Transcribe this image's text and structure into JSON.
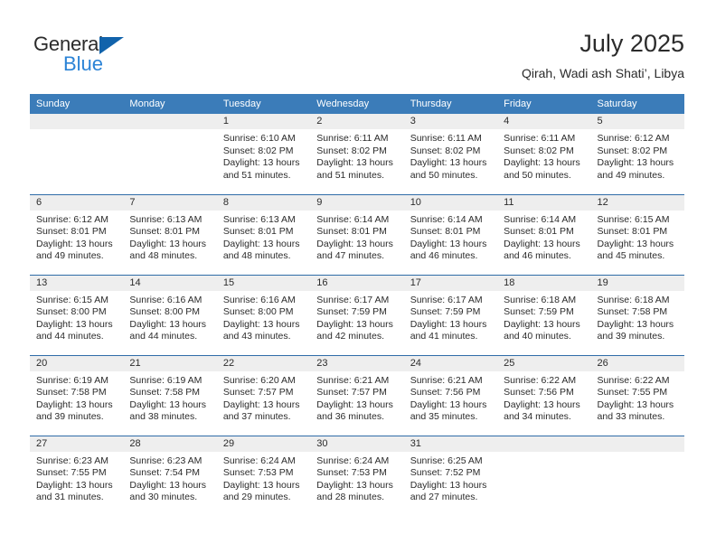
{
  "brand": {
    "name_top": "General",
    "name_bottom": "Blue",
    "logo_icon": "blue-triangle-icon",
    "accent_color": "#1163ab",
    "secondary_color": "#2b83d6"
  },
  "header": {
    "title": "July 2025",
    "subtitle": "Qirah, Wadi ash Shati’, Libya"
  },
  "theme": {
    "header_row_bg": "#3b7cb9",
    "header_row_text": "#ffffff",
    "daynum_band_bg": "#eeeeee",
    "week_divider": "#2f6ca8",
    "body_text": "#2b2b2b"
  },
  "weekday_headers": [
    "Sunday",
    "Monday",
    "Tuesday",
    "Wednesday",
    "Thursday",
    "Friday",
    "Saturday"
  ],
  "weeks": [
    [
      {
        "day": "",
        "empty": true
      },
      {
        "day": "",
        "empty": true
      },
      {
        "day": "1",
        "sunrise": "Sunrise: 6:10 AM",
        "sunset": "Sunset: 8:02 PM",
        "daylight_1": "Daylight: 13 hours",
        "daylight_2": "and 51 minutes."
      },
      {
        "day": "2",
        "sunrise": "Sunrise: 6:11 AM",
        "sunset": "Sunset: 8:02 PM",
        "daylight_1": "Daylight: 13 hours",
        "daylight_2": "and 51 minutes."
      },
      {
        "day": "3",
        "sunrise": "Sunrise: 6:11 AM",
        "sunset": "Sunset: 8:02 PM",
        "daylight_1": "Daylight: 13 hours",
        "daylight_2": "and 50 minutes."
      },
      {
        "day": "4",
        "sunrise": "Sunrise: 6:11 AM",
        "sunset": "Sunset: 8:02 PM",
        "daylight_1": "Daylight: 13 hours",
        "daylight_2": "and 50 minutes."
      },
      {
        "day": "5",
        "sunrise": "Sunrise: 6:12 AM",
        "sunset": "Sunset: 8:02 PM",
        "daylight_1": "Daylight: 13 hours",
        "daylight_2": "and 49 minutes."
      }
    ],
    [
      {
        "day": "6",
        "sunrise": "Sunrise: 6:12 AM",
        "sunset": "Sunset: 8:01 PM",
        "daylight_1": "Daylight: 13 hours",
        "daylight_2": "and 49 minutes."
      },
      {
        "day": "7",
        "sunrise": "Sunrise: 6:13 AM",
        "sunset": "Sunset: 8:01 PM",
        "daylight_1": "Daylight: 13 hours",
        "daylight_2": "and 48 minutes."
      },
      {
        "day": "8",
        "sunrise": "Sunrise: 6:13 AM",
        "sunset": "Sunset: 8:01 PM",
        "daylight_1": "Daylight: 13 hours",
        "daylight_2": "and 48 minutes."
      },
      {
        "day": "9",
        "sunrise": "Sunrise: 6:14 AM",
        "sunset": "Sunset: 8:01 PM",
        "daylight_1": "Daylight: 13 hours",
        "daylight_2": "and 47 minutes."
      },
      {
        "day": "10",
        "sunrise": "Sunrise: 6:14 AM",
        "sunset": "Sunset: 8:01 PM",
        "daylight_1": "Daylight: 13 hours",
        "daylight_2": "and 46 minutes."
      },
      {
        "day": "11",
        "sunrise": "Sunrise: 6:14 AM",
        "sunset": "Sunset: 8:01 PM",
        "daylight_1": "Daylight: 13 hours",
        "daylight_2": "and 46 minutes."
      },
      {
        "day": "12",
        "sunrise": "Sunrise: 6:15 AM",
        "sunset": "Sunset: 8:01 PM",
        "daylight_1": "Daylight: 13 hours",
        "daylight_2": "and 45 minutes."
      }
    ],
    [
      {
        "day": "13",
        "sunrise": "Sunrise: 6:15 AM",
        "sunset": "Sunset: 8:00 PM",
        "daylight_1": "Daylight: 13 hours",
        "daylight_2": "and 44 minutes."
      },
      {
        "day": "14",
        "sunrise": "Sunrise: 6:16 AM",
        "sunset": "Sunset: 8:00 PM",
        "daylight_1": "Daylight: 13 hours",
        "daylight_2": "and 44 minutes."
      },
      {
        "day": "15",
        "sunrise": "Sunrise: 6:16 AM",
        "sunset": "Sunset: 8:00 PM",
        "daylight_1": "Daylight: 13 hours",
        "daylight_2": "and 43 minutes."
      },
      {
        "day": "16",
        "sunrise": "Sunrise: 6:17 AM",
        "sunset": "Sunset: 7:59 PM",
        "daylight_1": "Daylight: 13 hours",
        "daylight_2": "and 42 minutes."
      },
      {
        "day": "17",
        "sunrise": "Sunrise: 6:17 AM",
        "sunset": "Sunset: 7:59 PM",
        "daylight_1": "Daylight: 13 hours",
        "daylight_2": "and 41 minutes."
      },
      {
        "day": "18",
        "sunrise": "Sunrise: 6:18 AM",
        "sunset": "Sunset: 7:59 PM",
        "daylight_1": "Daylight: 13 hours",
        "daylight_2": "and 40 minutes."
      },
      {
        "day": "19",
        "sunrise": "Sunrise: 6:18 AM",
        "sunset": "Sunset: 7:58 PM",
        "daylight_1": "Daylight: 13 hours",
        "daylight_2": "and 39 minutes."
      }
    ],
    [
      {
        "day": "20",
        "sunrise": "Sunrise: 6:19 AM",
        "sunset": "Sunset: 7:58 PM",
        "daylight_1": "Daylight: 13 hours",
        "daylight_2": "and 39 minutes."
      },
      {
        "day": "21",
        "sunrise": "Sunrise: 6:19 AM",
        "sunset": "Sunset: 7:58 PM",
        "daylight_1": "Daylight: 13 hours",
        "daylight_2": "and 38 minutes."
      },
      {
        "day": "22",
        "sunrise": "Sunrise: 6:20 AM",
        "sunset": "Sunset: 7:57 PM",
        "daylight_1": "Daylight: 13 hours",
        "daylight_2": "and 37 minutes."
      },
      {
        "day": "23",
        "sunrise": "Sunrise: 6:21 AM",
        "sunset": "Sunset: 7:57 PM",
        "daylight_1": "Daylight: 13 hours",
        "daylight_2": "and 36 minutes."
      },
      {
        "day": "24",
        "sunrise": "Sunrise: 6:21 AM",
        "sunset": "Sunset: 7:56 PM",
        "daylight_1": "Daylight: 13 hours",
        "daylight_2": "and 35 minutes."
      },
      {
        "day": "25",
        "sunrise": "Sunrise: 6:22 AM",
        "sunset": "Sunset: 7:56 PM",
        "daylight_1": "Daylight: 13 hours",
        "daylight_2": "and 34 minutes."
      },
      {
        "day": "26",
        "sunrise": "Sunrise: 6:22 AM",
        "sunset": "Sunset: 7:55 PM",
        "daylight_1": "Daylight: 13 hours",
        "daylight_2": "and 33 minutes."
      }
    ],
    [
      {
        "day": "27",
        "sunrise": "Sunrise: 6:23 AM",
        "sunset": "Sunset: 7:55 PM",
        "daylight_1": "Daylight: 13 hours",
        "daylight_2": "and 31 minutes."
      },
      {
        "day": "28",
        "sunrise": "Sunrise: 6:23 AM",
        "sunset": "Sunset: 7:54 PM",
        "daylight_1": "Daylight: 13 hours",
        "daylight_2": "and 30 minutes."
      },
      {
        "day": "29",
        "sunrise": "Sunrise: 6:24 AM",
        "sunset": "Sunset: 7:53 PM",
        "daylight_1": "Daylight: 13 hours",
        "daylight_2": "and 29 minutes."
      },
      {
        "day": "30",
        "sunrise": "Sunrise: 6:24 AM",
        "sunset": "Sunset: 7:53 PM",
        "daylight_1": "Daylight: 13 hours",
        "daylight_2": "and 28 minutes."
      },
      {
        "day": "31",
        "sunrise": "Sunrise: 6:25 AM",
        "sunset": "Sunset: 7:52 PM",
        "daylight_1": "Daylight: 13 hours",
        "daylight_2": "and 27 minutes."
      },
      {
        "day": "",
        "empty": true
      },
      {
        "day": "",
        "empty": true
      }
    ]
  ]
}
